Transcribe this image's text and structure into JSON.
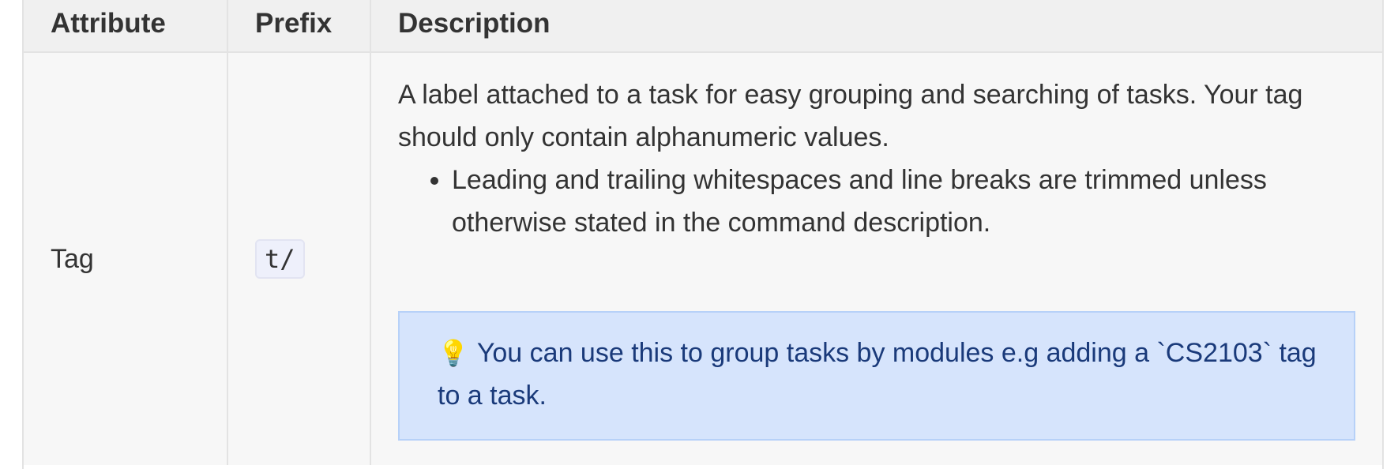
{
  "table": {
    "headers": [
      "Attribute",
      "Prefix",
      "Description"
    ],
    "rows": [
      {
        "attribute": "Tag",
        "prefix": "t/",
        "description": "A label attached to a task for easy grouping and searching of tasks. Your tag should only contain alphanumeric values.",
        "bullets": [
          "Leading and trailing whitespaces and line breaks are trimmed unless otherwise stated in the command description."
        ],
        "tip": {
          "icon": "lightbulb-icon",
          "glyph": "💡",
          "text": "You can use this to group tasks by modules e.g adding a `CS2103` tag to a task."
        }
      }
    ]
  },
  "colors": {
    "header_bg": "#f0f0f0",
    "cell_bg": "#f7f7f7",
    "tip_bg": "#d6e4fc",
    "tip_text": "#1a3a7a"
  }
}
